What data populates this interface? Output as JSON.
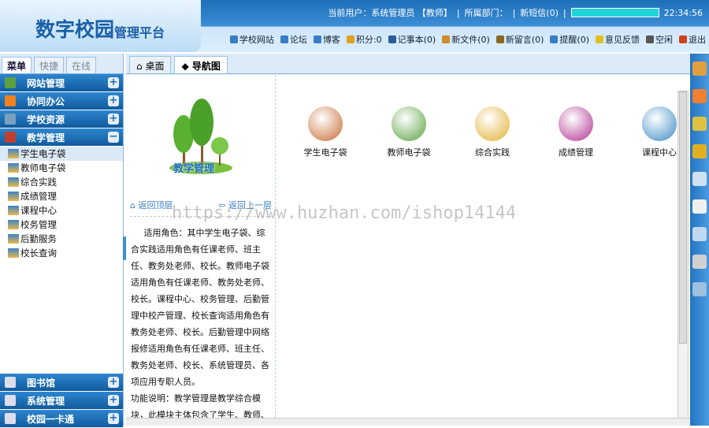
{
  "logo": {
    "main": "数字校园",
    "sub": "管理平台"
  },
  "userbar": {
    "user": "当前用户：系统管理员 【教师】",
    "sep1": "|",
    "dept": "所属部门：",
    "sep2": "|",
    "sms": "新短信(0)",
    "sep3": "|",
    "time": "22:34:56"
  },
  "toolbar": [
    {
      "label": "学校网站",
      "color": "#3a7dc4"
    },
    {
      "label": "论坛",
      "color": "#3a7dc4"
    },
    {
      "label": "博客",
      "color": "#3a7dc4"
    },
    {
      "label": "积分:0",
      "color": "#e0a020"
    },
    {
      "label": "记事本(0)",
      "color": "#2b5e9a"
    },
    {
      "label": "新文件(0)",
      "color": "#d08a30"
    },
    {
      "label": "新留言(0)",
      "color": "#8a6a20"
    },
    {
      "label": "提醒(0)",
      "color": "#3a7dc4"
    },
    {
      "label": "意见反馈",
      "color": "#e0c020"
    },
    {
      "label": "空闲",
      "color": "#555"
    },
    {
      "label": "退出",
      "color": "#d04020"
    }
  ],
  "left_tabs": [
    "菜单",
    "快捷",
    "在线"
  ],
  "menu": [
    {
      "label": "网站管理",
      "sign": "+",
      "color": "#5aa040"
    },
    {
      "label": "协同办公",
      "sign": "+",
      "color": "#f08020"
    },
    {
      "label": "学校资源",
      "sign": "+",
      "color": "#7aa0c0"
    },
    {
      "label": "教学管理",
      "sign": "−",
      "color": "#c04030"
    }
  ],
  "submenu": [
    "学生电子袋",
    "教师电子袋",
    "综合实践",
    "成绩管理",
    "课程中心",
    "校务管理",
    "后勤服务",
    "校长查询"
  ],
  "bottom_menu": [
    {
      "label": "图书馆",
      "sign": "+"
    },
    {
      "label": "系统管理",
      "sign": "+"
    },
    {
      "label": "校园一卡通",
      "sign": "+"
    }
  ],
  "main_tabs": [
    "桌面",
    "导航图"
  ],
  "panel": {
    "title": "教学管理",
    "back_top": "返回顶层",
    "back_up": "返回上一层",
    "desc": "适用角色：其中学生电子袋、综合实践适用角色有任课老师、班主任、教务处老师、校长。教师电子袋适用角色有任课老师、教务处老师、校长。课程中心、校务管理、后勤管理中校产管理、校长查询适用角色有教务处老师、校长。后勤管理中网络报修适用角色有任课老师、班主任、教务处老师、校长、系统管理员、各项应用专职人员。",
    "desc2": "功能说明：教学管理是教学综合模块，此模块主体包含了学生、教师、"
  },
  "apps": [
    {
      "label": "学生电子袋",
      "color": "#c86a30"
    },
    {
      "label": "教师电子袋",
      "color": "#5aa040"
    },
    {
      "label": "综合实践",
      "color": "#e0b030"
    },
    {
      "label": "成绩管理",
      "color": "#b03090"
    },
    {
      "label": "课程中心",
      "color": "#3a8ac4"
    }
  ],
  "watermark": "https://www.huzhan.com/ishop14144"
}
